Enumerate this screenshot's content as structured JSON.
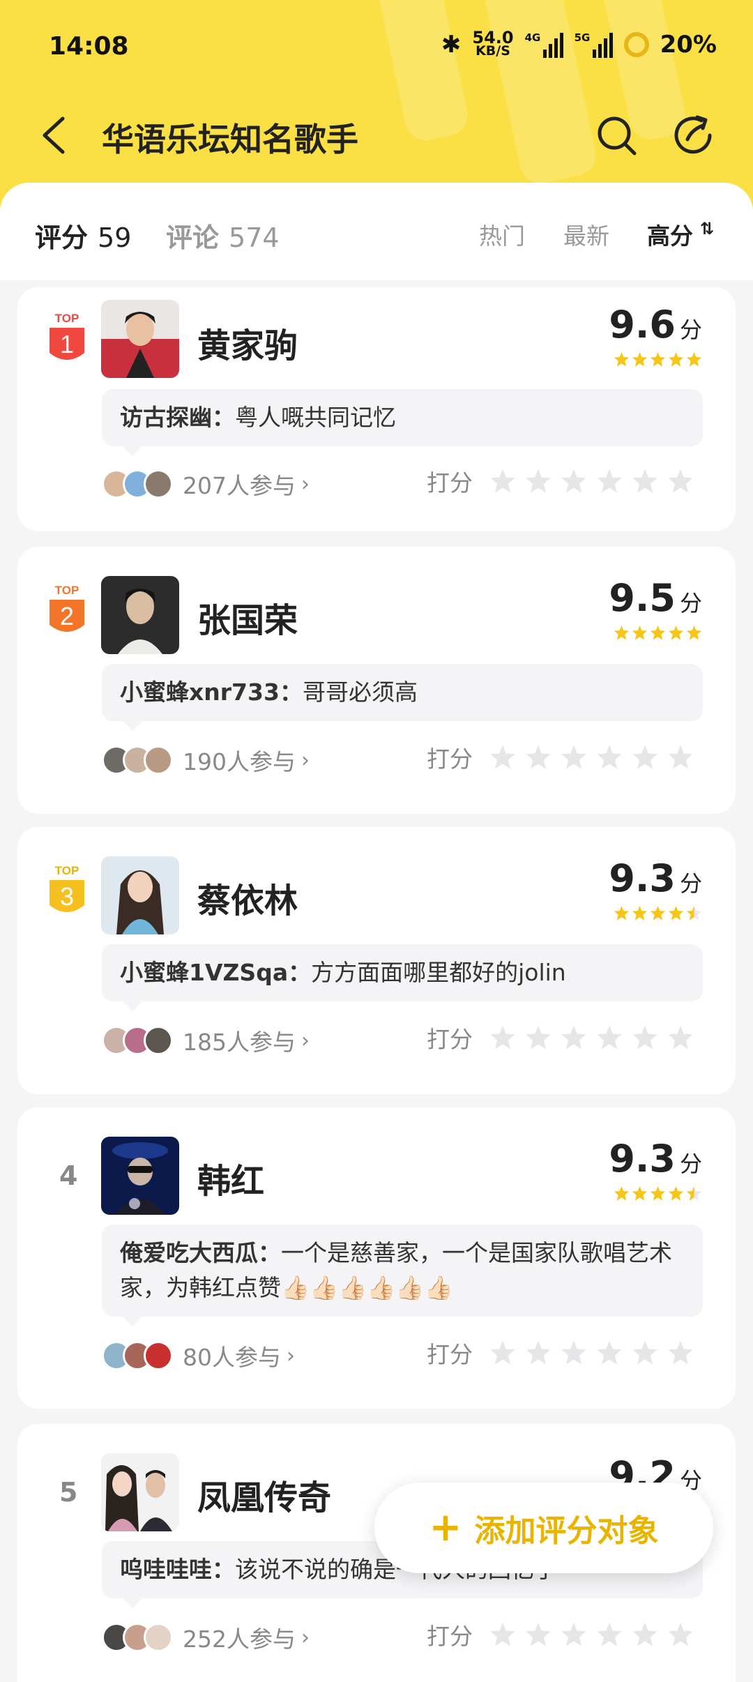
{
  "status_bar": {
    "time": "14:08",
    "net_speed_value": "54.0",
    "net_speed_unit": "KB/S",
    "signal1_label": "4G",
    "signal2_label": "5G",
    "battery": "20%"
  },
  "nav": {
    "title": "华语乐坛知名歌手"
  },
  "tabs": {
    "score_label": "评分",
    "score_count": "59",
    "comment_label": "评论",
    "comment_count": "574"
  },
  "sort": {
    "hot": "热门",
    "new": "最新",
    "high": "高分",
    "active": "high"
  },
  "cards": [
    {
      "rank": "1",
      "top_label": "TOP",
      "name": "黄家驹",
      "score": "9.6",
      "unit": "分",
      "stars": 5,
      "commenter": "访古探幽：",
      "comment": "粤人嘅共同记忆",
      "participants": "207人参与",
      "rate_label": "打分"
    },
    {
      "rank": "2",
      "top_label": "TOP",
      "name": "张国荣",
      "score": "9.5",
      "unit": "分",
      "stars": 5,
      "commenter": "小蜜蜂xnr733：",
      "comment": "哥哥必须高",
      "participants": "190人参与",
      "rate_label": "打分"
    },
    {
      "rank": "3",
      "top_label": "TOP",
      "name": "蔡依林",
      "score": "9.3",
      "unit": "分",
      "stars": 4.5,
      "commenter": "小蜜蜂1VZSqa：",
      "comment": "方方面面哪里都好的jolin",
      "participants": "185人参与",
      "rate_label": "打分"
    },
    {
      "rank": "4",
      "name": "韩红",
      "score": "9.3",
      "unit": "分",
      "stars": 4.5,
      "commenter": "俺爱吃大西瓜：",
      "comment": "一个是慈善家，一个是国家队歌唱艺术家，为韩红点赞👍🏻👍🏻👍🏻👍🏻👍🏻👍🏻",
      "participants": "80人参与",
      "rate_label": "打分"
    },
    {
      "rank": "5",
      "name": "凤凰传奇",
      "score": "9.2",
      "unit": "分",
      "stars": 4.5,
      "commenter": "呜哇哇哇：",
      "comment": "该说不说的确是一代人的回忆了",
      "participants": "252人参与",
      "rate_label": "打分"
    }
  ],
  "fab": {
    "plus": "+",
    "label": "添加评分对象"
  },
  "colors": {
    "header_yellow": "#fbe045",
    "star_yellow": "#f5c518",
    "accent_gold": "#e8b400",
    "rank1": "#f0483e",
    "rank2": "#f2752a",
    "rank3": "#f6c021"
  }
}
